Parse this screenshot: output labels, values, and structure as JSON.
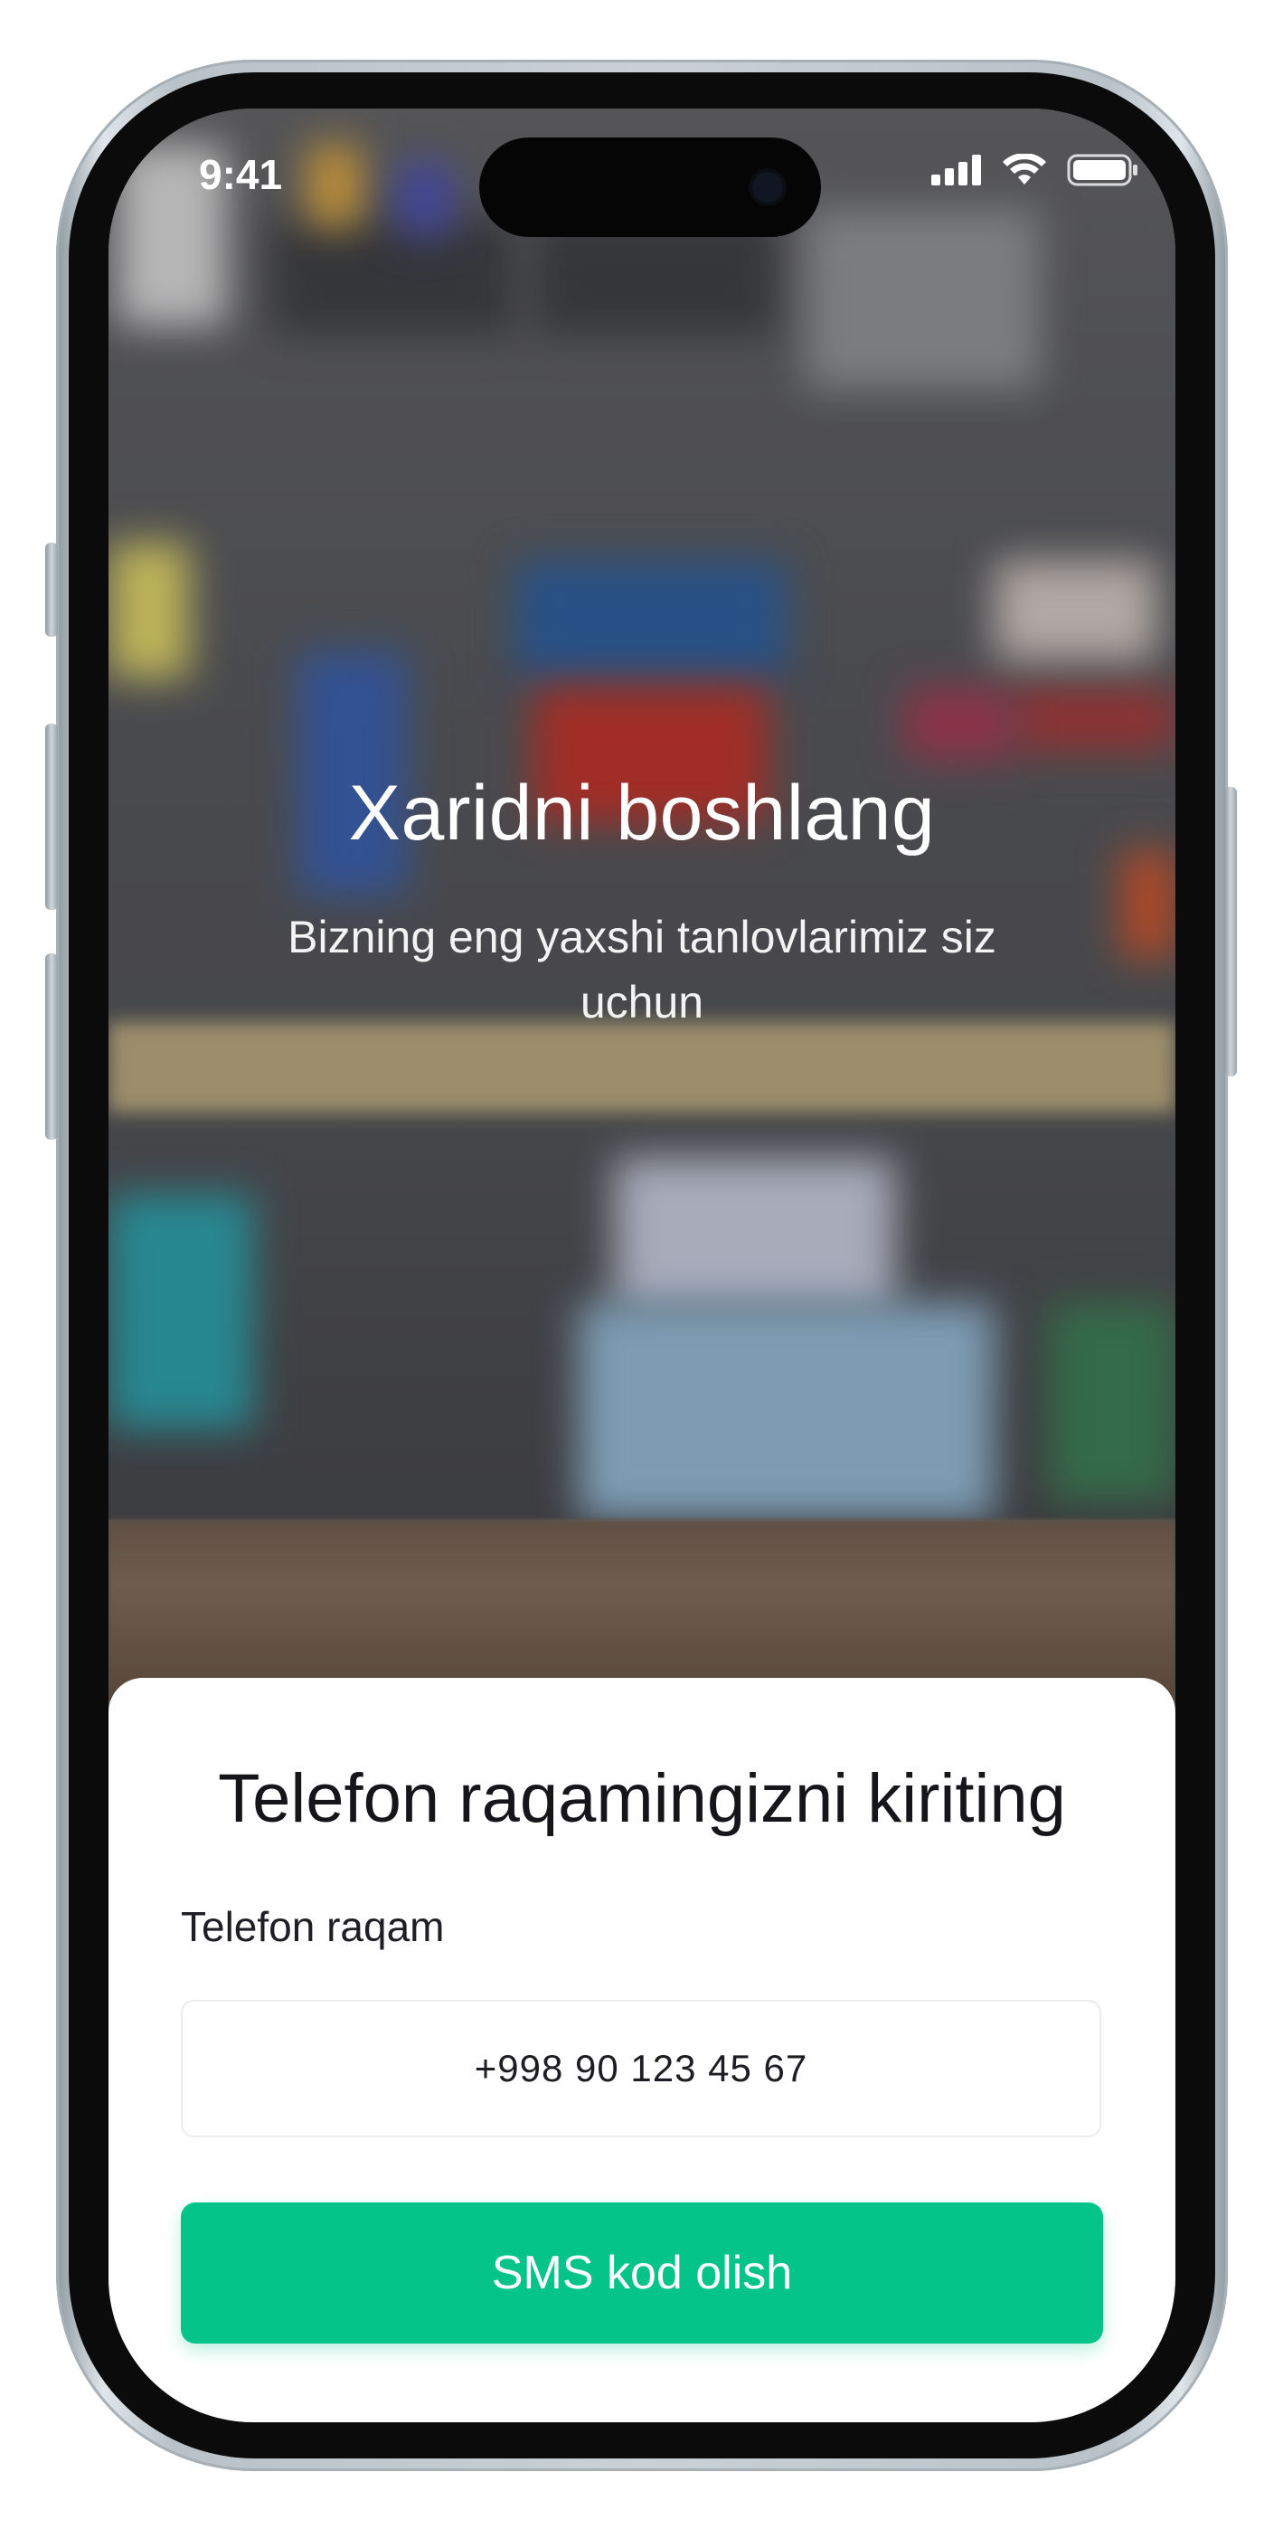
{
  "status_bar": {
    "time": "9:41",
    "icons": [
      "cellular-signal-icon",
      "wifi-icon",
      "battery-icon"
    ]
  },
  "hero": {
    "title": "Xaridni boshlang",
    "subtitle": "Bizning eng yaxshi tanlovlarimiz siz uchun",
    "background": "blurred-workshop-photo"
  },
  "login_sheet": {
    "title": "Telefon raqamingizni kiriting",
    "phone_label": "Telefon raqam",
    "phone_placeholder": "+998 90 123 45 67",
    "submit_label": "SMS kod olish"
  },
  "colors": {
    "accent": "#05c489",
    "text_dark": "#15151a",
    "sheet_bg": "#ffffff"
  }
}
